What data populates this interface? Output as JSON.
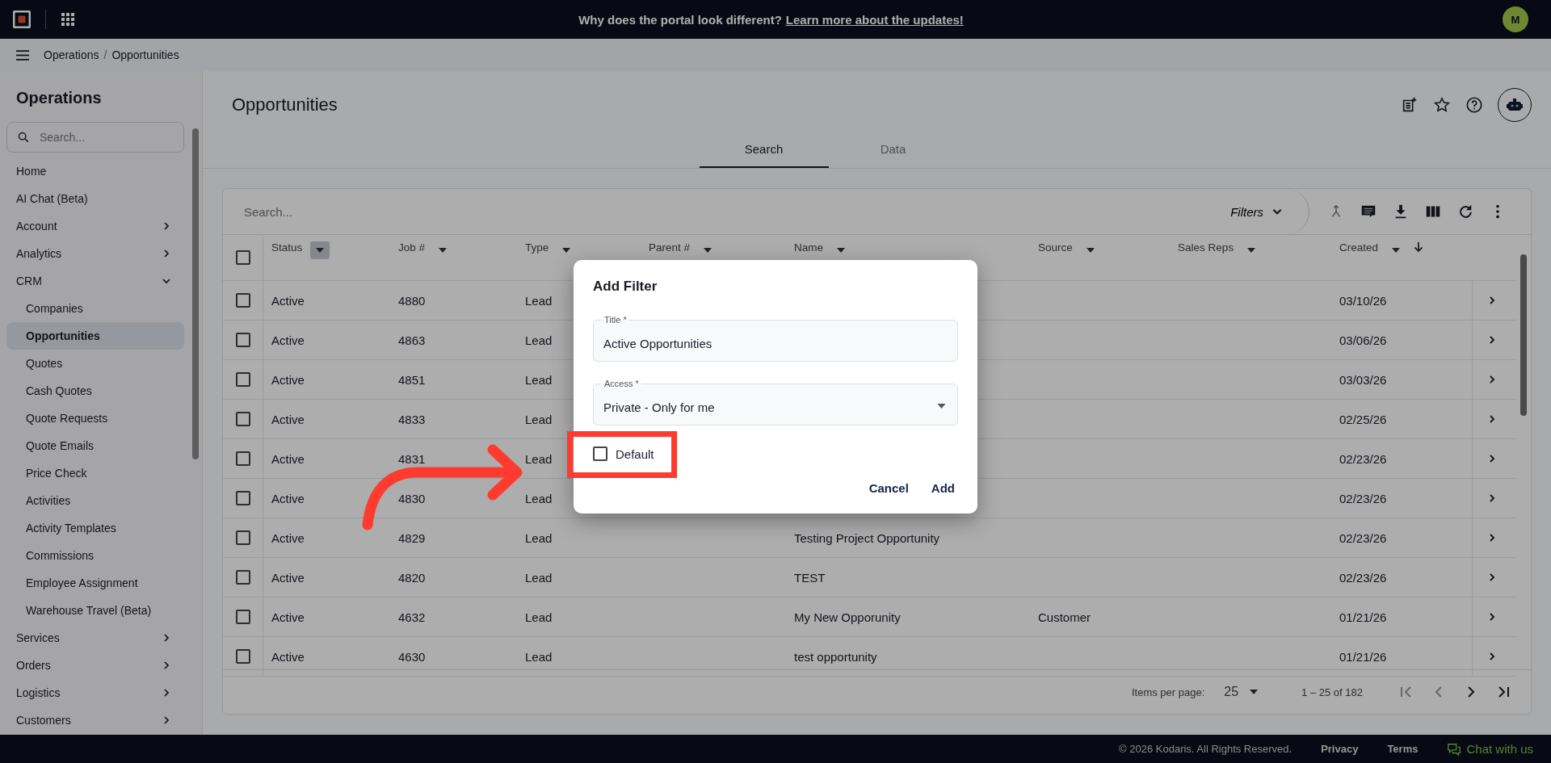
{
  "top_bar": {
    "announcement": "Why does the portal look different?",
    "announcement_link": "Learn more about the updates!",
    "avatar": "M"
  },
  "breadcrumb": {
    "separator": "/",
    "items": [
      "Operations",
      "Opportunities"
    ]
  },
  "sidebar": {
    "title": "Operations",
    "search_placeholder": "Search...",
    "items": [
      {
        "label": "Home",
        "kind": "link",
        "selected": false
      },
      {
        "label": "AI Chat (Beta)",
        "kind": "link",
        "selected": false
      },
      {
        "label": "Account",
        "kind": "group",
        "expanded": false,
        "selected": false
      },
      {
        "label": "Analytics",
        "kind": "group",
        "expanded": false,
        "selected": false
      },
      {
        "label": "CRM",
        "kind": "group",
        "expanded": true,
        "selected": false,
        "children": [
          {
            "label": "Companies",
            "selected": false
          },
          {
            "label": "Opportunities",
            "selected": true
          },
          {
            "label": "Quotes",
            "selected": false
          },
          {
            "label": "Cash Quotes",
            "selected": false
          },
          {
            "label": "Quote Requests",
            "selected": false
          },
          {
            "label": "Quote Emails",
            "selected": false
          },
          {
            "label": "Price Check",
            "selected": false
          },
          {
            "label": "Activities",
            "selected": false
          },
          {
            "label": "Activity Templates",
            "selected": false
          },
          {
            "label": "Commissions",
            "selected": false
          },
          {
            "label": "Employee Assignment",
            "selected": false
          },
          {
            "label": "Warehouse Travel (Beta)",
            "selected": false
          }
        ]
      },
      {
        "label": "Services",
        "kind": "group",
        "expanded": false,
        "selected": false
      },
      {
        "label": "Orders",
        "kind": "group",
        "expanded": false,
        "selected": false
      },
      {
        "label": "Logistics",
        "kind": "group",
        "expanded": false,
        "selected": false
      },
      {
        "label": "Customers",
        "kind": "group",
        "expanded": false,
        "selected": false
      }
    ]
  },
  "page": {
    "title": "Opportunities",
    "tabs": [
      {
        "label": "Search",
        "selected": true
      },
      {
        "label": "Data",
        "selected": false
      }
    ]
  },
  "table": {
    "search_placeholder": "Search...",
    "filters_label": "Filters",
    "select_all_checked": false,
    "columns": [
      {
        "label": "Status",
        "filter_active": true
      },
      {
        "label": "Job #",
        "filter_active": false
      },
      {
        "label": "Type",
        "filter_active": false
      },
      {
        "label": "Parent #",
        "filter_active": false
      },
      {
        "label": "Name",
        "filter_active": false
      },
      {
        "label": "Source",
        "filter_active": false
      },
      {
        "label": "Sales Reps",
        "filter_active": false
      },
      {
        "label": "Created",
        "filter_active": false,
        "sorted": true
      }
    ],
    "rows": [
      {
        "checked": false,
        "status": "Active",
        "job": "4880",
        "type": "Lead",
        "created": "03/10/26"
      },
      {
        "checked": false,
        "status": "Active",
        "job": "4863",
        "type": "Lead",
        "created": "03/06/26"
      },
      {
        "checked": false,
        "status": "Active",
        "job": "4851",
        "type": "Lead",
        "created": "03/03/26"
      },
      {
        "checked": false,
        "status": "Active",
        "job": "4833",
        "type": "Lead",
        "created": "02/25/26"
      },
      {
        "checked": false,
        "status": "Active",
        "job": "4831",
        "type": "Lead",
        "created": "02/23/26"
      },
      {
        "checked": false,
        "status": "Active",
        "job": "4830",
        "type": "Lead",
        "created": "02/23/26"
      },
      {
        "checked": false,
        "status": "Active",
        "job": "4829",
        "type": "Lead",
        "name": "Testing Project Opportunity",
        "created": "02/23/26"
      },
      {
        "checked": false,
        "status": "Active",
        "job": "4820",
        "type": "Lead",
        "name": "TEST",
        "created": "02/23/26"
      },
      {
        "checked": false,
        "status": "Active",
        "job": "4632",
        "type": "Lead",
        "name": "My New Opporunity",
        "source": "Customer",
        "created": "01/21/26"
      },
      {
        "checked": false,
        "status": "Active",
        "job": "4630",
        "type": "Lead",
        "name": "test opportunity",
        "created": "01/21/26"
      }
    ],
    "pagination": {
      "items_per_page_label": "Items per page:",
      "page_size": "25",
      "range": "1 – 25 of 182",
      "buttons": [
        {
          "kind": "first",
          "disabled": true
        },
        {
          "kind": "prev",
          "disabled": true
        },
        {
          "kind": "next",
          "disabled": false
        },
        {
          "kind": "last",
          "disabled": false
        }
      ]
    }
  },
  "dialog": {
    "title": "Add Filter",
    "fields": [
      {
        "kind": "text",
        "label": "Title *",
        "value": "Active Opportunities"
      },
      {
        "kind": "select",
        "label": "Access *",
        "value": "Private - Only for me"
      }
    ],
    "checkbox": {
      "label": "Default",
      "checked": false
    },
    "buttons": [
      "Cancel",
      "Add"
    ]
  },
  "footer": {
    "copyright": "© 2026 Kodaris. All Rights Reserved.",
    "links": [
      "Privacy",
      "Terms"
    ],
    "chat": "Chat with us"
  }
}
